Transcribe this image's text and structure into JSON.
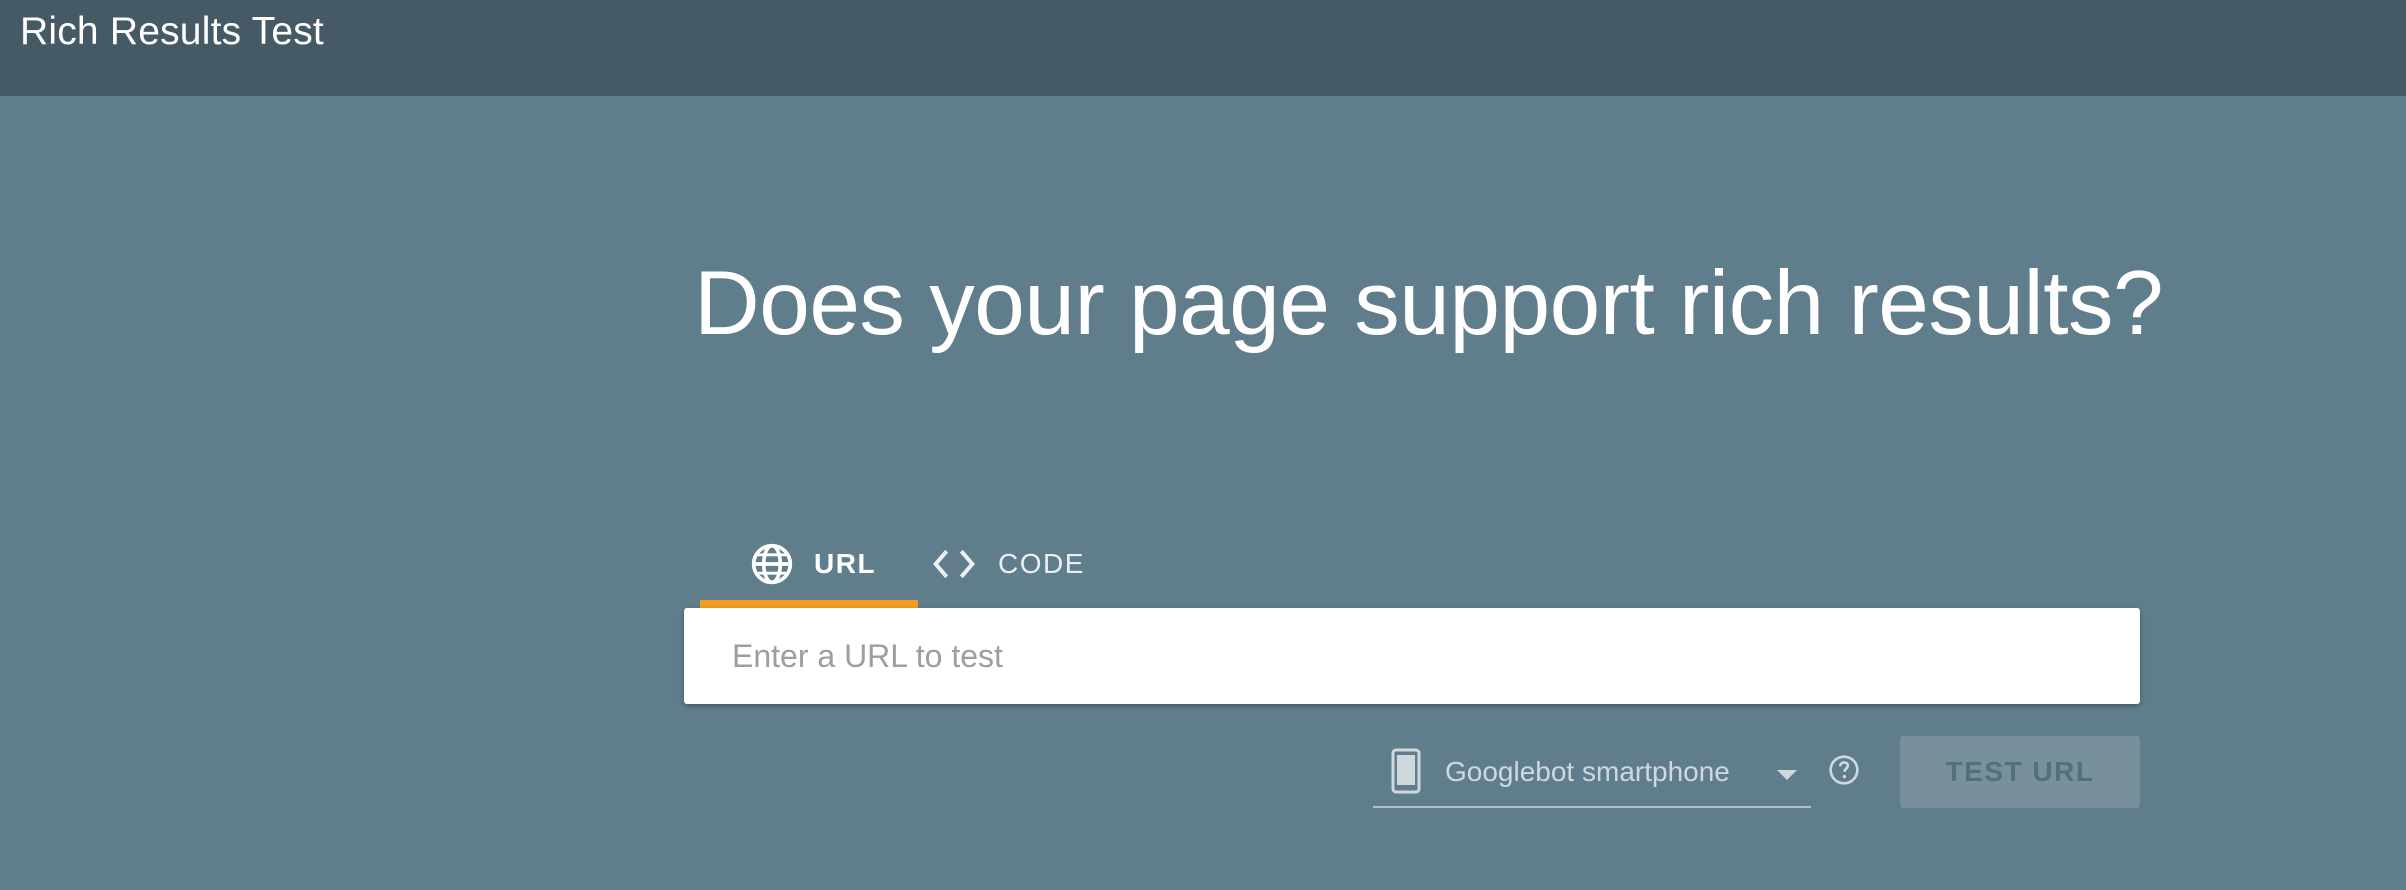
{
  "header": {
    "title": "Rich Results Test"
  },
  "main": {
    "headline": "Does your page support rich results?",
    "tabs": [
      {
        "label": "URL",
        "icon": "globe-icon",
        "selected": true
      },
      {
        "label": "CODE",
        "icon": "code-icon",
        "selected": false
      }
    ],
    "url_input": {
      "placeholder": "Enter a URL to test",
      "value": ""
    },
    "device_select": {
      "icon": "smartphone-icon",
      "selected": "Googlebot smartphone"
    },
    "help_icon": "help-circle-icon",
    "test_button_label": "TEST URL"
  },
  "colors": {
    "topbar": "#455a64",
    "background": "#607d8b",
    "tab_indicator": "#f29c22",
    "button_bg": "#78909c",
    "button_text": "#546e7a"
  }
}
